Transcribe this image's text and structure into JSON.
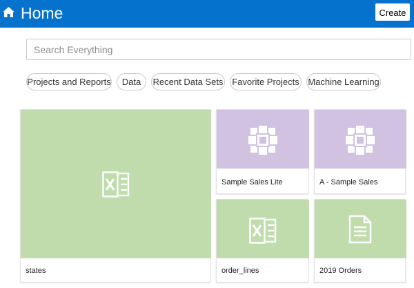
{
  "header": {
    "title": "Home",
    "create_label": "Create"
  },
  "search": {
    "placeholder": "Search Everything"
  },
  "filters": [
    "Projects and Reports",
    "Data",
    "Recent Data Sets",
    "Favorite Projects",
    "Machine Learning"
  ],
  "tiles": [
    {
      "label": "states",
      "type": "excel-icon"
    },
    {
      "label": "Sample Sales Lite",
      "type": "subject-area-icon"
    },
    {
      "label": "A - Sample Sales",
      "type": "subject-area-icon"
    },
    {
      "label": "order_lines",
      "type": "excel-icon"
    },
    {
      "label": "2019 Orders",
      "type": "document-icon"
    }
  ],
  "colors": {
    "header": "#0572ce",
    "data_tile": "#c0dcac",
    "subject_area_tile": "#d0c2e0"
  }
}
